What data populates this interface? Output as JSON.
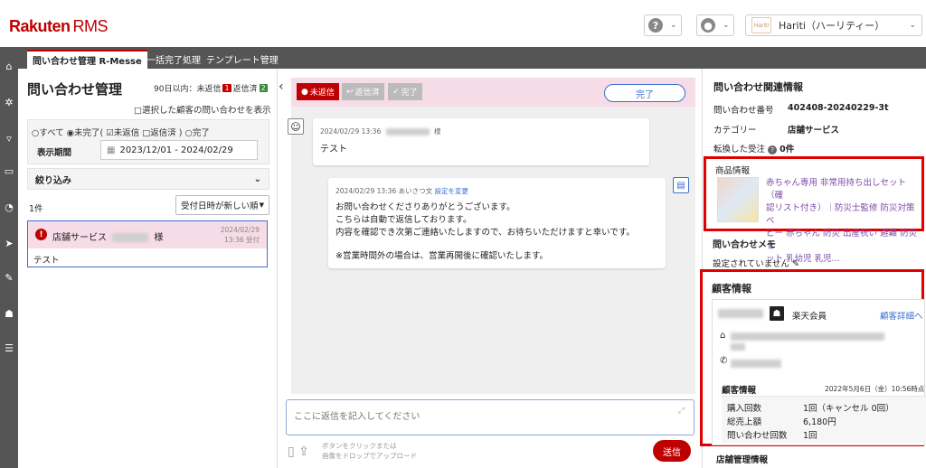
{
  "header": {
    "logo_main": "Rakuten",
    "logo_sub": "RMS",
    "help_icon": "?",
    "shop_logo_text": "Hariti",
    "shop_name": "Hariti（ハーリティー）"
  },
  "tabs": [
    {
      "label": "問い合わせ管理 R-Messe"
    },
    {
      "label": "一括完了処理"
    },
    {
      "label": "テンプレート管理"
    }
  ],
  "left": {
    "title": "問い合わせ管理",
    "counts_prefix": "90日以内：未返信",
    "unreplied_count": "1",
    "replied_label": "返信済",
    "replied_count": "2",
    "show_selected_label": "□選択した顧客の問い合わせを表示",
    "status_filter_text": "○すべて ◉未完了( ☑未返信 □返信済 ) ○完了",
    "period_label": "表示期間",
    "period_value": "2023/12/01 - 2024/02/29",
    "narrow_label": "絞り込み",
    "result_count": "1件",
    "sort_value": "受付日時が新しい順",
    "inquiry": {
      "category": "店舗サービス",
      "honorific": "様",
      "date": "2024/02/29",
      "time": "13:36 受付",
      "body": "テスト"
    }
  },
  "middle": {
    "status_unreplied": "未返信",
    "status_replied": "返信済",
    "status_done": "完了",
    "done_button": "完了",
    "msg1": {
      "meta": "2024/02/29 13:36",
      "honorific": "様",
      "text": "テスト"
    },
    "msg2": {
      "meta": "2024/02/29 13:36  あいさつ文",
      "settings_link": "設定を変更",
      "line1": "お問い合わせくださりありがとうございます。",
      "line2": "こちらは自動で返信しております。",
      "line3": "内容を確認でき次第ご連絡いたしますので、お待ちいただけますと幸いです。",
      "line4": "※営業時間外の場合は、営業再開後に確認いたします。"
    },
    "reply_placeholder": "ここに返信を記入してください",
    "attach_line1": "ボタンをクリックまたは",
    "attach_line2": "画像をドロップでアップロード",
    "send_button": "送信"
  },
  "right": {
    "title": "問い合わせ関連情報",
    "inquiry_no_label": "問い合わせ番号",
    "inquiry_no": "402408-20240229-3t",
    "category_label": "カテゴリー",
    "category": "店舗サービス",
    "order_label": "転換した受注",
    "order_value": "0件",
    "product_label": "商品情報",
    "product_text": "赤ちゃん専用 非常用持ち出しセット（確\n認リスト付き）｜防災士監修 防災対策 ベ\nビー 赤ちゃん 防災 出産祝い 避難 防災セ\nット 乳幼児 乳児...",
    "memo_label": "問い合わせメモ",
    "memo_value": "設定されていません",
    "customer_title": "顧客情報",
    "member_label": "楽天会員",
    "detail_link": "顧客詳細へ",
    "ci_header": "顧客情報",
    "ci_date": "2022年5月6日（金）10:56時点",
    "purchases_label": "購入回数",
    "purchases_value": "1回（キャンセル 0回）",
    "sales_label": "総売上額",
    "sales_value": "6,180円",
    "inquiries_label": "問い合わせ回数",
    "inquiries_value": "1回",
    "store_mgmt_label": "店舗管理情報"
  },
  "icons": {
    "sidebar": [
      "home-icon",
      "gear-icon",
      "cart-icon",
      "shipping-icon",
      "chart-icon",
      "send-icon",
      "tool-icon",
      "users-icon",
      "list-icon"
    ]
  },
  "colors": {
    "brand": "#bf0000",
    "link": "#3b6fd0",
    "unreplied_bg": "#f6dce6",
    "highlight_border": "#e00000"
  }
}
